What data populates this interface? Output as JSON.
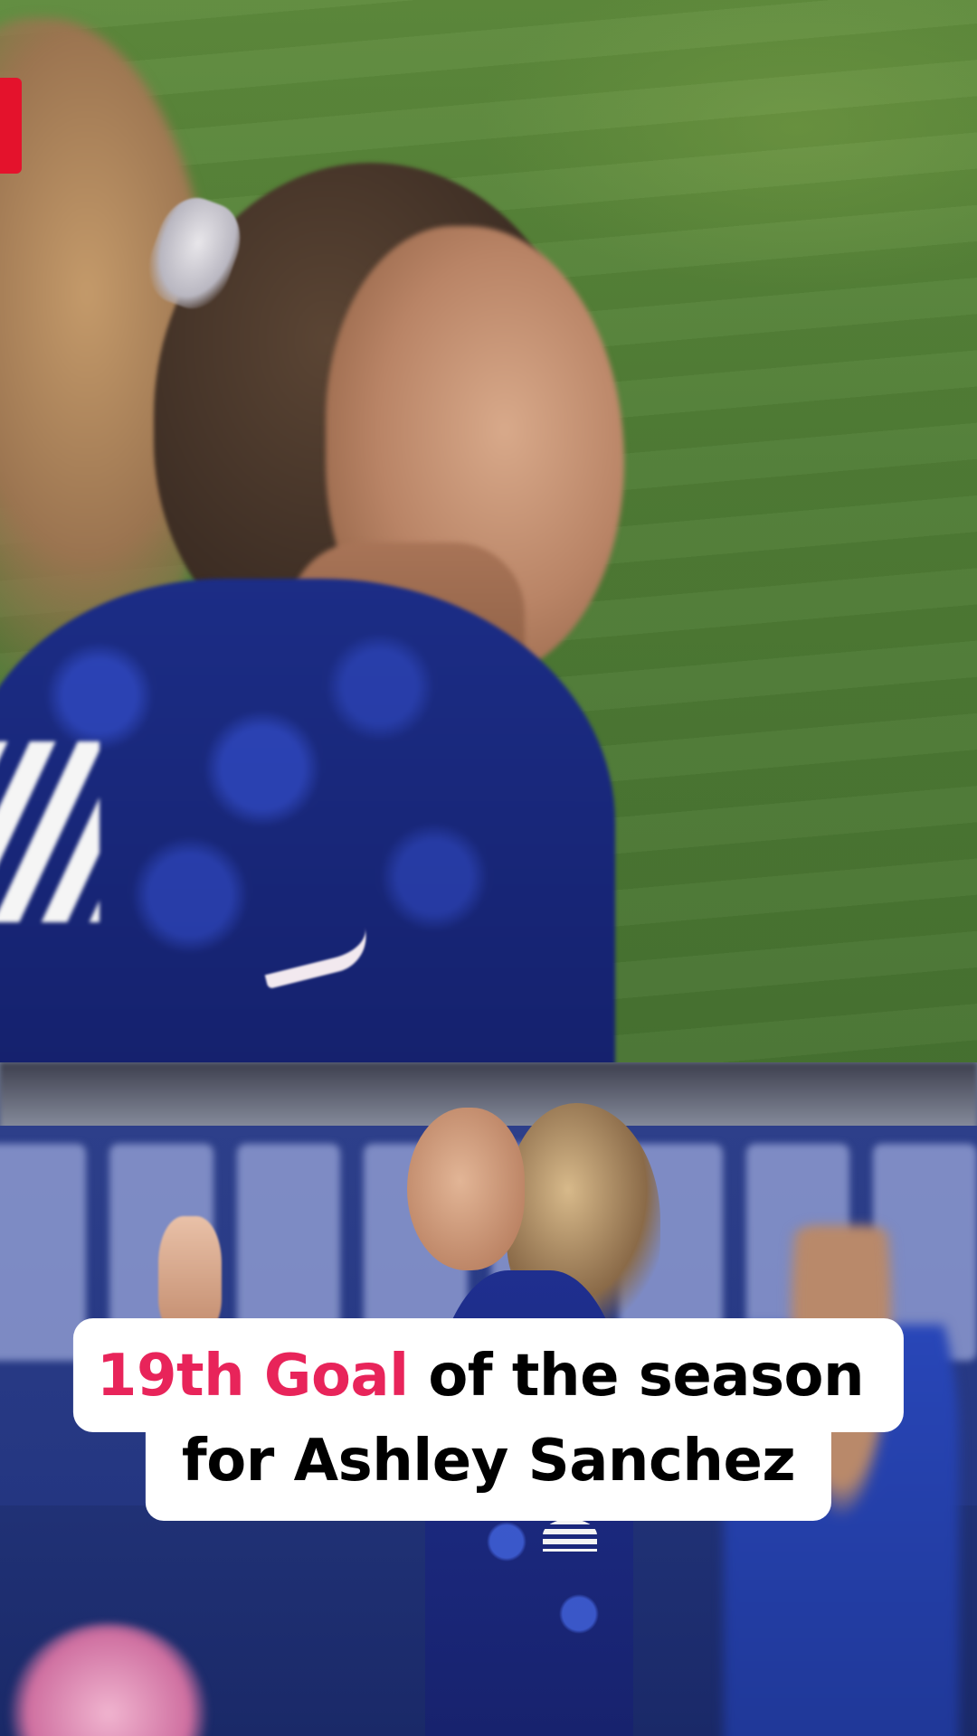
{
  "caption": {
    "line1_highlight": "19th Goal",
    "line1_rest": " of the season",
    "line2": "for Ashley Sanchez"
  },
  "colors": {
    "highlight": "#e8245a",
    "caption_background": "#ffffff",
    "caption_text": "#000000",
    "badge": "#e4122c"
  }
}
